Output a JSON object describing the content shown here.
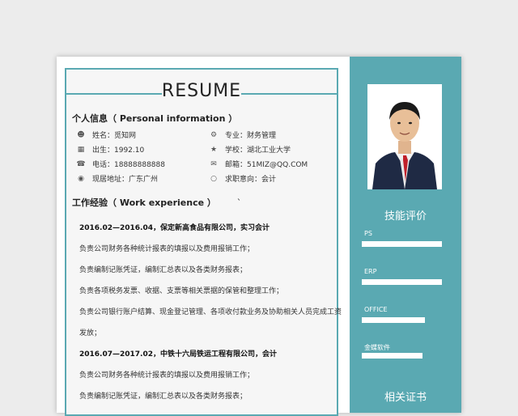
{
  "resume": {
    "title": "RESUME",
    "personal_section_title": "个人信息（ Personal information ）",
    "personal_info": [
      {
        "label": "姓名：觅知网",
        "icon": "user-icon"
      },
      {
        "label": "专业：财务管理",
        "icon": "major-icon"
      },
      {
        "label": "出生：1992.10",
        "icon": "calendar-icon"
      },
      {
        "label": "学校：湖北工业大学",
        "icon": "school-icon"
      },
      {
        "label": "电话：18888888888",
        "icon": "phone-icon"
      },
      {
        "label": "邮箱：51MIZ@QQ.COM",
        "icon": "mail-icon"
      },
      {
        "label": "现居地址：广东广州",
        "icon": "location-icon"
      },
      {
        "label": "求职意向：会计",
        "icon": "chat-icon"
      }
    ],
    "work_section_title": "工作经验（ Work experience ）",
    "work_tick": "`",
    "jobs": [
      {
        "header": "2016.02—2016.04，保定新高食品有限公司，实习会计",
        "lines": [
          "负责公司财务各种统计报表的填报以及费用报销工作；",
          "负责编制记账凭证，编制汇总表以及各类财务报表；",
          "负责各项税务发票、收据、支票等相关票据的保管和整理工作；",
          "负责公司银行账户结算、现金登记管理、各项收付款业务及协助相关人员完成工资",
          "发放；"
        ]
      },
      {
        "header": "2016.07—2017.02，中铁十六局铁运工程有限公司，会计",
        "lines": [
          "负责公司财务各种统计报表的填报以及费用报销工作；",
          "负责编制记账凭证，编制汇总表以及各类财务报表；"
        ]
      }
    ]
  },
  "sidebar": {
    "skills_title": "技能评价",
    "skills": [
      {
        "name": "PS",
        "level": 0.95
      },
      {
        "name": "ERP",
        "level": 0.95
      },
      {
        "name": "OFFICE",
        "level": 0.75
      },
      {
        "name": "金蝶软件",
        "level": 0.72
      }
    ],
    "certs_title": "相关证书"
  },
  "colors": {
    "accent": "#5aa9b2",
    "paper": "#ffffff",
    "background": "#ececec"
  }
}
